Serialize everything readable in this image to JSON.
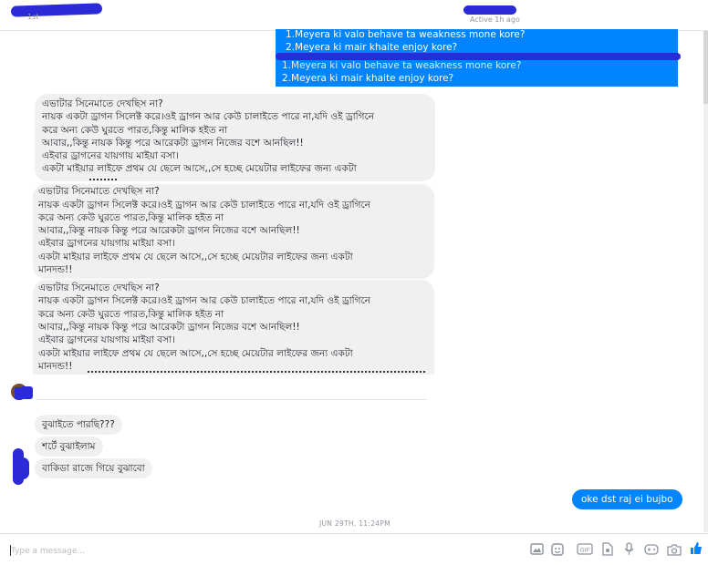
{
  "header": {
    "subtitle": "1st",
    "active_status": "Active 1h ago"
  },
  "quoted_message": {
    "lines": [
      "1.Meyera ki valo behave ta weakness mone kore?",
      "2.Meyera ki mair khaite enjoy kore?",
      "1.Meyera ki valo behave ta weakness mone kore?",
      "2.Meyera ki mair khaite enjoy kore?"
    ]
  },
  "incoming_long": {
    "lines": [
      "এভাটার সিনেমাতে দেখছিস না?",
      "নায়ক একটা ড্রাগন সিলেক্ট করে।ওই ড্রাগন আর কেউ চালাইতে পারে না,যদি ওই ড্রাগিনে",
      "করে অন্য কেউ ঘুরতে পারত,কিন্তু মালিক হইত না",
      "আবার,,কিন্তু নায়ক কিন্তু পরে আরেকটা ড্রাগন নিজের বশে আনছিল!!",
      "এইবার ড্রাগনের যায়গায় মাইয়া বসা।",
      "একটা মাইয়ার লাইফে প্রথম যে ছেলে আসে,,সে হচ্ছে মেয়েটার লাইফের জন্য একটা",
      "মানদন্ড!!"
    ]
  },
  "incoming_short": [
    "বুঝাইতে পারছি???",
    "শর্টে বুঝাইলাম",
    "বাকিডা রাজে গিয়ে বুঝাবো"
  ],
  "outgoing": {
    "message": "oke dst raj ei bujbo"
  },
  "timestamp": "JUN 29TH, 11:24PM",
  "composer": {
    "placeholder": "Type a message...",
    "icons": [
      "image-icon",
      "sticker-icon",
      "emoji-icon",
      "gif-icon",
      "file-icon",
      "mic-icon",
      "game-icon",
      "camera-icon",
      "like-icon"
    ]
  },
  "colors": {
    "accent": "#0084ff",
    "bubble_grey": "#f1f0f0",
    "scribble": "#2a2ad6"
  }
}
